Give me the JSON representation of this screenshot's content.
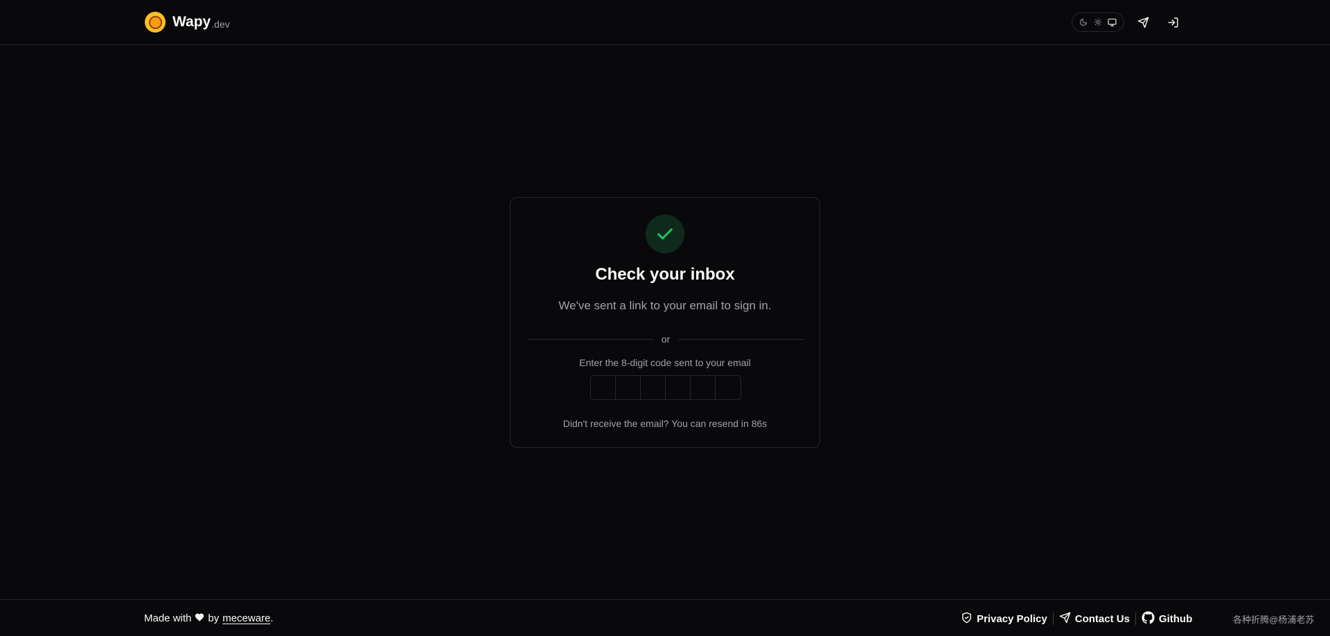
{
  "header": {
    "brand_name": "Wapy",
    "brand_tld": ".dev",
    "theme_options": [
      "moon-icon",
      "sun-icon",
      "monitor-icon"
    ],
    "icons": [
      "send-icon",
      "sign-in-icon"
    ]
  },
  "card": {
    "title": "Check your inbox",
    "subtitle": "We've sent a link to your email to sign in.",
    "divider_text": "or",
    "code_label": "Enter the 8-digit code sent to your email",
    "code_values": [
      "",
      "",
      "",
      "",
      "",
      ""
    ],
    "resend_text": "Didn't receive the email? You can resend in 86s"
  },
  "footer": {
    "made_with_prefix": "Made with",
    "made_with_by": "by",
    "author": "meceware",
    "author_suffix": ".",
    "privacy": "Privacy Policy",
    "contact": "Contact Us",
    "github": "Github",
    "watermark": "各种折腾@杨浦老苏"
  },
  "colors": {
    "background": "#09090b",
    "border": "#27272a",
    "accent_green": "#22c55e",
    "logo_yellow": "#fbbf24"
  }
}
